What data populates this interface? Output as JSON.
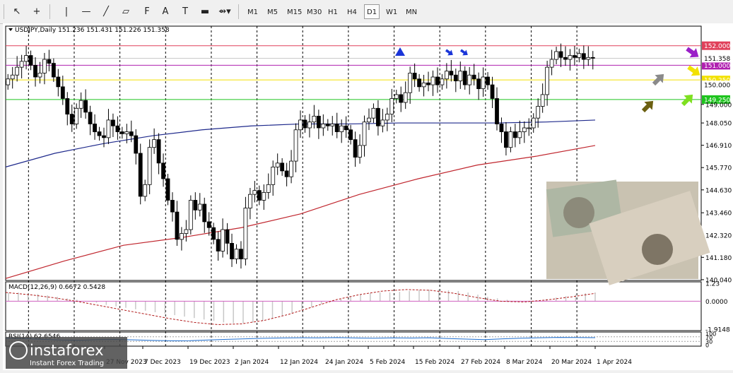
{
  "toolbar": {
    "tools": [
      {
        "name": "cursor-arrow-icon",
        "glyph": "↖"
      },
      {
        "name": "crosshair-icon",
        "glyph": "+"
      },
      {
        "name": "vertical-line-icon",
        "glyph": "|"
      },
      {
        "name": "horizontal-line-icon",
        "glyph": "—"
      },
      {
        "name": "trendline-icon",
        "glyph": "╱"
      },
      {
        "name": "channel-icon",
        "glyph": "▱"
      },
      {
        "name": "fibonacci-icon",
        "glyph": "F"
      },
      {
        "name": "text-icon",
        "glyph": "A"
      },
      {
        "name": "text-label-icon",
        "glyph": "T"
      },
      {
        "name": "rectangle-icon",
        "glyph": "▬"
      },
      {
        "name": "shapes-menu-icon",
        "glyph": "⇴▾"
      }
    ],
    "timeframes": [
      "M1",
      "M5",
      "M15",
      "M30",
      "H1",
      "H4",
      "D1",
      "W1",
      "MN"
    ],
    "active_timeframe": "D1"
  },
  "chart": {
    "header": "USDJPY,Daily  151.236 151.431 151.226 151.358",
    "ylim": [
      140.0,
      153.0
    ],
    "y_ticks": [
      "149.000",
      "148.050",
      "146.910",
      "145.770",
      "144.630",
      "143.460",
      "142.320",
      "141.180",
      "140.040"
    ],
    "x_labels": [
      "27 Nov 2023",
      "7 Dec 2023",
      "19 Dec 2023",
      "2 Jan 2024",
      "12 Jan 2024",
      "24 Jan 2024",
      "5 Feb 2024",
      "15 Feb 2024",
      "27 Feb 2024",
      "8 Mar 2024",
      "20 Mar 2024",
      "1 Apr 2024"
    ],
    "h_levels": [
      {
        "price": 152.0,
        "label": "152.000",
        "color": "#e0405a"
      },
      {
        "price": 151.0,
        "label": "151.000",
        "color": "#b020b0"
      },
      {
        "price": 150.25,
        "label": "150.250",
        "color": "#f2e100"
      },
      {
        "price": 149.25,
        "label": "149.250",
        "color": "#1ec41e"
      }
    ],
    "price_tags": [
      {
        "price": 151.358,
        "label": "151.358",
        "bg": "#ffffff",
        "fg": "#000000"
      },
      {
        "price": 150.0,
        "label": "150.000",
        "bg": "#ffffff",
        "fg": "#000000"
      }
    ],
    "colors": {
      "bull": "#ffffff",
      "bear": "#000000",
      "sma_slow": "#c0262e",
      "sma_fast": "#1f2a8c",
      "grid": "#000000"
    }
  },
  "chart_data": {
    "type": "candlestick",
    "symbol": "USDJPY",
    "timeframe": "Daily",
    "ohlc_last": {
      "open": 151.236,
      "high": 151.431,
      "low": 151.226,
      "close": 151.358
    },
    "closes": [
      150.3,
      150.5,
      150.9,
      151.2,
      151.5,
      151.0,
      150.4,
      150.6,
      151.3,
      151.1,
      150.4,
      149.9,
      149.3,
      148.5,
      148.0,
      148.8,
      149.2,
      148.6,
      148.0,
      147.6,
      147.4,
      147.3,
      148.2,
      147.9,
      147.6,
      147.5,
      147.6,
      147.4,
      146.5,
      144.3,
      144.9,
      146.8,
      147.2,
      146.0,
      145.2,
      144.1,
      143.5,
      142.1,
      142.4,
      142.6,
      144.1,
      143.6,
      143.9,
      143.0,
      142.7,
      142.1,
      141.5,
      142.6,
      141.9,
      141.1,
      141.6,
      141.1,
      143.7,
      144.4,
      144.6,
      144.1,
      144.5,
      144.9,
      145.8,
      146.0,
      145.6,
      145.3,
      146.1,
      147.7,
      148.2,
      147.8,
      148.1,
      148.4,
      147.8,
      148.0,
      147.9,
      148.0,
      147.6,
      147.9,
      147.7,
      147.2,
      146.3,
      146.9,
      148.1,
      148.3,
      148.8,
      147.9,
      148.2,
      148.5,
      149.3,
      149.5,
      149.1,
      149.6,
      150.6,
      150.3,
      149.9,
      150.1,
      150.0,
      150.4,
      150.0,
      150.3,
      150.7,
      150.5,
      150.2,
      150.7,
      150.0,
      150.5,
      150.3,
      149.8,
      150.4,
      150.0,
      149.3,
      148.0,
      147.6,
      146.8,
      147.6,
      147.3,
      147.6,
      147.8,
      147.8,
      148.3,
      148.9,
      149.5,
      150.9,
      151.3,
      151.7,
      151.4,
      151.3,
      151.5,
      151.4,
      151.6,
      151.3,
      151.4,
      151.358
    ],
    "sma_fast": [
      145.8,
      146.5,
      147.0,
      147.4,
      147.7,
      147.9,
      148.0,
      148.0,
      148.05,
      148.05,
      148.05,
      148.1,
      148.2
    ],
    "sma_slow": [
      140.1,
      141.0,
      141.8,
      142.2,
      142.7,
      143.4,
      144.4,
      145.2,
      145.9,
      146.35,
      146.9
    ],
    "annotations": [
      {
        "type": "triangle-up",
        "price": 151.2,
        "color": "#1a35d8"
      },
      {
        "type": "arrow-down-right",
        "price": 151.2,
        "color": "#1a35d8"
      },
      {
        "type": "arrow-down-right",
        "price": 151.2,
        "color": "#1a35d8"
      },
      {
        "type": "arrow-down-right",
        "price": 151.0,
        "color": "#9a1fc8"
      },
      {
        "type": "arrow-down-right",
        "price": 150.25,
        "color": "#f2e100"
      },
      {
        "type": "arrow-up-right",
        "price": 150.0,
        "color": "#8a8a8a"
      },
      {
        "type": "arrow-up-right",
        "price": 149.0,
        "color": "#6b6010"
      },
      {
        "type": "arrow-up-right",
        "price": 149.25,
        "color": "#7ee020"
      }
    ],
    "macd": {
      "label": "MACD(12,26,9) 0.6672 0.5428",
      "params": [
        12,
        26,
        9
      ],
      "main": 0.6672,
      "signal": 0.5428,
      "ylim": [
        -1.9148,
        1.23
      ],
      "y_ticks": [
        "1.23",
        "0.0000",
        "-1.9148"
      ],
      "histogram": [
        0.6,
        0.6,
        0.55,
        0.5,
        0.4,
        0.3,
        0.2,
        0.1,
        0.0,
        -0.1,
        -0.25,
        -0.35,
        -0.45,
        -0.55,
        -0.65,
        -0.75,
        -0.85,
        -0.95,
        -1.05,
        -1.15,
        -1.25,
        -1.35,
        -1.45,
        -1.5,
        -1.5,
        -1.45,
        -1.35,
        -1.2,
        -1.0,
        -0.8,
        -0.6,
        -0.4,
        -0.2,
        0.0,
        0.15,
        0.3,
        0.45,
        0.55,
        0.6,
        0.6,
        0.65,
        0.7,
        0.75,
        0.8,
        0.8,
        0.75,
        0.7,
        0.6,
        0.45,
        0.3,
        0.2,
        0.1,
        0.0,
        -0.05,
        0.05,
        0.15,
        0.25,
        0.35,
        0.45,
        0.55,
        0.6
      ],
      "signal_line": [
        0.6,
        0.45,
        0.25,
        0.0,
        -0.3,
        -0.6,
        -0.9,
        -1.2,
        -1.45,
        -1.6,
        -1.55,
        -1.3,
        -0.9,
        -0.4,
        0.1,
        0.45,
        0.7,
        0.8,
        0.75,
        0.55,
        0.25,
        0.0,
        -0.05,
        0.1,
        0.3,
        0.54
      ]
    },
    "rsi": {
      "label": "RSI(14) 62.6546",
      "period": 14,
      "value": 62.6546,
      "ylim": [
        0,
        100
      ],
      "y_ticks": [
        "100",
        "70",
        "30",
        "0"
      ],
      "values": [
        58,
        55,
        48,
        42,
        40,
        45,
        47,
        43,
        38,
        35,
        36,
        42,
        48,
        52,
        57,
        60,
        62,
        61,
        63,
        60,
        58,
        61,
        59,
        62,
        55,
        50,
        45,
        52,
        58,
        62,
        65,
        64,
        62.6546
      ]
    }
  },
  "watermark": {
    "brand": "instaforex",
    "tagline": "Instant Forex Trading"
  }
}
